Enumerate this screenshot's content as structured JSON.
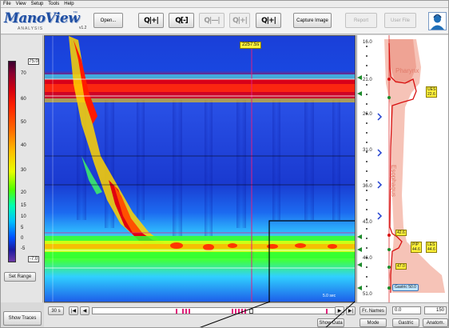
{
  "menu": [
    "File",
    "View",
    "Setup",
    "Tools",
    "Help"
  ],
  "logo": {
    "brand": "ManoView",
    "tm": "™",
    "sub": "ANALYSIS",
    "version": "v1.2"
  },
  "toolbar": {
    "open_label": "Open...",
    "capture_label": "Capture Image",
    "report_label": "Report",
    "user_file_label": "User File",
    "zoom1": "Q|+|",
    "zoom2": "Q[-]",
    "zoom3": "Q|—|",
    "zoom4": "Q|+|",
    "zoom5": "Q|+|"
  },
  "colorscale": {
    "max_value": "75.0",
    "min_value": "-7.0",
    "ticks": [
      "70",
      "60",
      "50",
      "40",
      "30",
      "20",
      "15",
      "10",
      "5",
      "0",
      "-5"
    ]
  },
  "set_range_label": "Set Range",
  "show_traces_label": "Show Traces",
  "plot": {
    "time_marker": "2257.5s",
    "scale_note": "5.0 sec"
  },
  "anatomy": {
    "depths": [
      "16.0",
      "21.0",
      "26.0",
      "31.0",
      "36.0",
      "41.0",
      "46.0",
      "51.0"
    ],
    "pharynx_label": "Pharynx",
    "esophagus_label": "Esophagus",
    "ues_tag": "UES",
    "ues_value": "22.6",
    "top_tag": "42.6",
    "pip_tag": "PIP",
    "pip_value": "44.6",
    "les_tag": "LES",
    "les_value": "44.6",
    "lower_tag": "47.0",
    "gastric_label": "Gastric 50.0",
    "colors": {
      "pharynx": "#f4a898",
      "esophagus_text": "#e07a6a",
      "ues_curve": "#d81010",
      "tag_bg": "#fff23a"
    }
  },
  "bottom": {
    "window_label": "30 s",
    "show_data_label": "Show Data",
    "fr_names_label": "Fr. Names",
    "field_value": "0.0",
    "right_value": "150",
    "mode_label": "Mode",
    "gastric_label": "Gastric",
    "anatomy_label": "Anatom."
  }
}
